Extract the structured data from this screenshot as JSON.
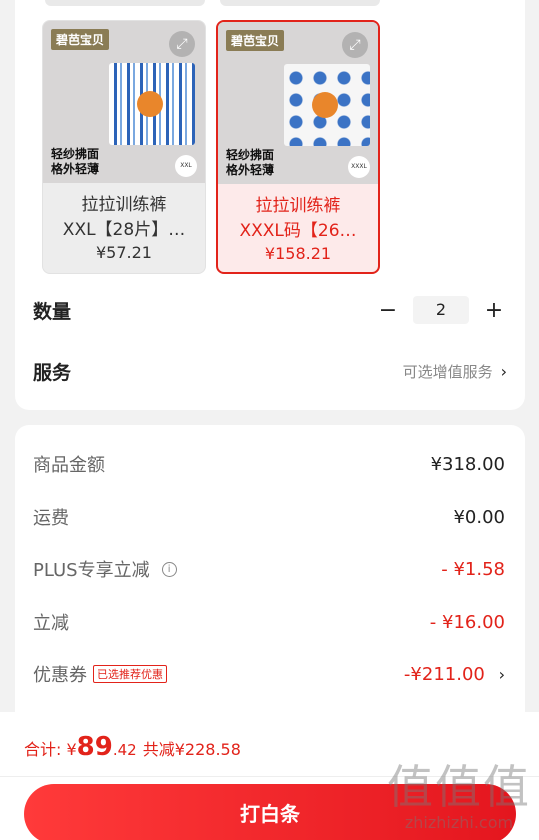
{
  "variants": [
    {
      "brand": "碧芭宝贝",
      "slogan_line1": "轻纱拂面",
      "slogan_line2": "格外轻薄",
      "size_badge": "XXL",
      "name_line1": "拉拉训练裤",
      "name_line2": "XXL【28片】…",
      "price": "¥57.21",
      "selected": false
    },
    {
      "brand": "碧芭宝贝",
      "slogan_line1": "轻纱拂面",
      "slogan_line2": "格外轻薄",
      "size_badge": "XXXL",
      "name_line1": "拉拉训练裤",
      "name_line2": "XXXL码【26…",
      "price": "¥158.21",
      "selected": true
    }
  ],
  "quantity": {
    "label": "数量",
    "minus": "−",
    "value": "2",
    "plus": "+"
  },
  "service": {
    "label": "服务",
    "value": "可选增值服务",
    "chevron": "›"
  },
  "summary": {
    "goods_label": "商品金额",
    "goods_value": "¥318.00",
    "shipping_label": "运费",
    "shipping_value": "¥0.00",
    "plus_label": "PLUS专享立减",
    "plus_value": "- ¥1.58",
    "plus_info_icon": "info-icon",
    "discount_label": "立减",
    "discount_value": "- ¥16.00",
    "coupon_label": "优惠券",
    "coupon_tag": "已选推荐优惠",
    "coupon_value": "-¥211.00",
    "coupon_chevron": "›"
  },
  "footer": {
    "total_prefix": "合计: ¥",
    "total_int": "89",
    "total_dec": ".42",
    "saved": "共减¥228.58",
    "pay_button": "打白条"
  },
  "watermark": {
    "big": "值值值",
    "small": "zhizhizhi.com"
  },
  "colors": {
    "accent": "#e2231a",
    "selected_bg": "#fdeaea",
    "page_bg": "#f2f2f2"
  }
}
